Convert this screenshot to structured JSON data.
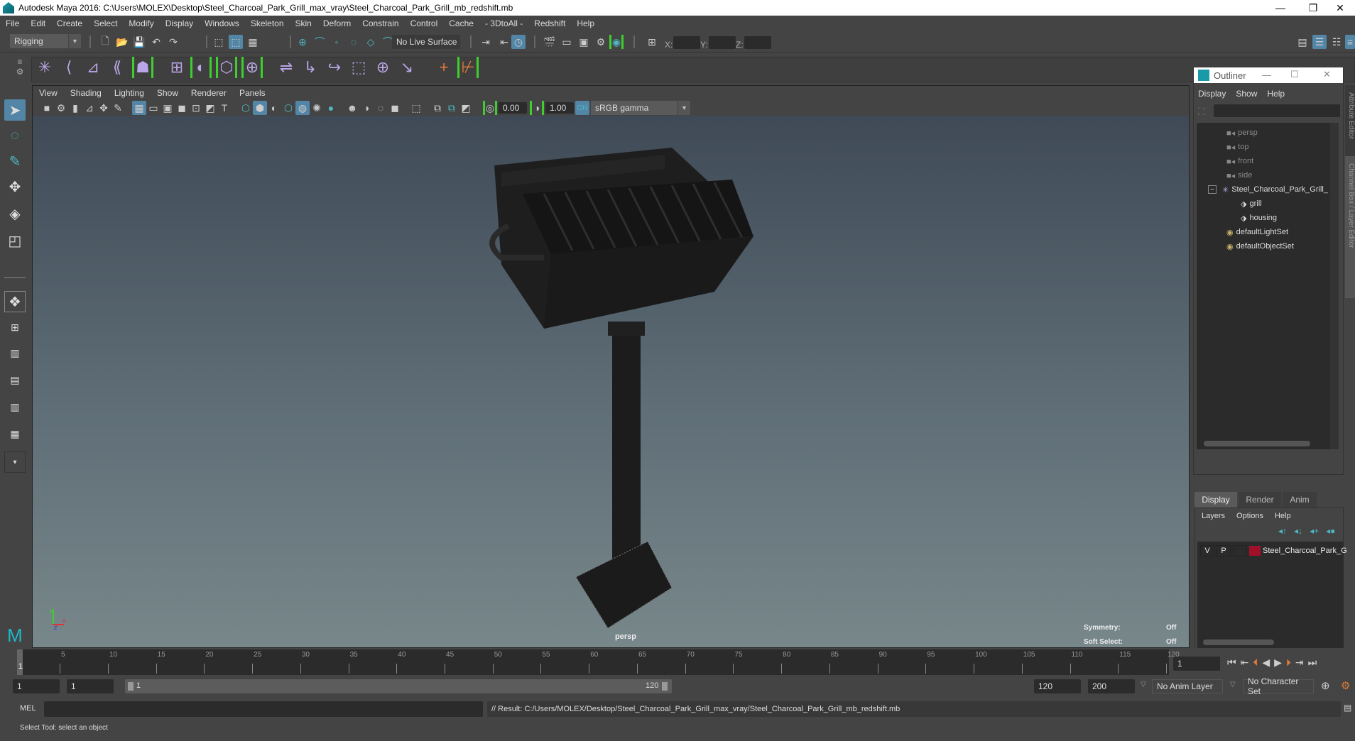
{
  "window": {
    "title": "Autodesk Maya 2016: C:\\Users\\MOLEX\\Desktop\\Steel_Charcoal_Park_Grill_max_vray\\Steel_Charcoal_Park_Grill_mb_redshift.mb",
    "minimize": "—",
    "restore": "❐",
    "close": "✕"
  },
  "menubar": [
    "File",
    "Edit",
    "Create",
    "Select",
    "Modify",
    "Display",
    "Windows",
    "Skeleton",
    "Skin",
    "Deform",
    "Constrain",
    "Control",
    "Cache",
    "- 3DtoAll -",
    "Redshift",
    "Help"
  ],
  "status_line": {
    "menu_set": "Rigging",
    "live_surface": "No Live Surface",
    "x_label": "X:",
    "y_label": "Y:",
    "z_label": "Z:",
    "x_value": "",
    "y_value": "",
    "z_value": ""
  },
  "panel": {
    "menus": [
      "View",
      "Shading",
      "Lighting",
      "Show",
      "Renderer",
      "Panels"
    ],
    "exposure": "0.00",
    "gamma": "1.00",
    "color_space": "sRGB gamma",
    "camera_label": "persp",
    "hud": {
      "symmetry_label": "Symmetry:",
      "symmetry_value": "Off",
      "soft_select_label": "Soft Select:",
      "soft_select_value": "Off"
    },
    "axis": {
      "x": "x",
      "y": "y",
      "z": "z"
    }
  },
  "outliner": {
    "title": "Outliner",
    "menus": [
      "Display",
      "Show",
      "Help"
    ],
    "search_value": "",
    "items": [
      {
        "label": "persp",
        "icon": "camera-icon",
        "dim": true,
        "indent": 0
      },
      {
        "label": "top",
        "icon": "camera-icon",
        "dim": true,
        "indent": 0
      },
      {
        "label": "front",
        "icon": "camera-icon",
        "dim": true,
        "indent": 0
      },
      {
        "label": "side",
        "icon": "camera-icon",
        "dim": true,
        "indent": 0
      },
      {
        "label": "Steel_Charcoal_Park_Grill_",
        "icon": "group-icon",
        "dim": false,
        "indent": 0,
        "expanded": true
      },
      {
        "label": "grill",
        "icon": "mesh-icon",
        "dim": false,
        "indent": 1
      },
      {
        "label": "housing",
        "icon": "mesh-icon",
        "dim": false,
        "indent": 1
      },
      {
        "label": "defaultLightSet",
        "icon": "set-icon",
        "dim": false,
        "indent": 0
      },
      {
        "label": "defaultObjectSet",
        "icon": "set-icon",
        "dim": false,
        "indent": 0
      }
    ]
  },
  "side_tabs": [
    "Attribute Editor",
    "Channel Box / Layer Editor"
  ],
  "layer_editor": {
    "tabs": [
      "Display",
      "Render",
      "Anim"
    ],
    "active_tab": "Display",
    "menus": [
      "Layers",
      "Options",
      "Help"
    ],
    "layers": [
      {
        "v": "V",
        "p": "P",
        "name": "Steel_Charcoal_Park_G",
        "color": "#a0102a"
      }
    ]
  },
  "timeline": {
    "ticks": [
      "5",
      "10",
      "15",
      "20",
      "25",
      "30",
      "35",
      "40",
      "45",
      "50",
      "55",
      "60",
      "65",
      "70",
      "75",
      "80",
      "85",
      "90",
      "95",
      "100",
      "105",
      "110",
      "115",
      "120"
    ],
    "current_frame_marker": "1",
    "current_frame": "1"
  },
  "range": {
    "start": "1",
    "playback_start": "1",
    "slider_start": "1",
    "slider_end": "120",
    "playback_end": "120",
    "end": "200",
    "anim_layer": "No Anim Layer",
    "character_set": "No Character Set"
  },
  "command_line": {
    "language": "MEL",
    "input": "",
    "result": "// Result: C:/Users/MOLEX/Desktop/Steel_Charcoal_Park_Grill_max_vray/Steel_Charcoal_Park_Grill_mb_redshift.mb"
  },
  "help_line": "Select Tool: select an object",
  "colors": {
    "accent_blue": "#5285a6",
    "green_bracket": "#3ecf2f",
    "layer_color": "#a0102a",
    "playback_orange": "#e07b39"
  }
}
